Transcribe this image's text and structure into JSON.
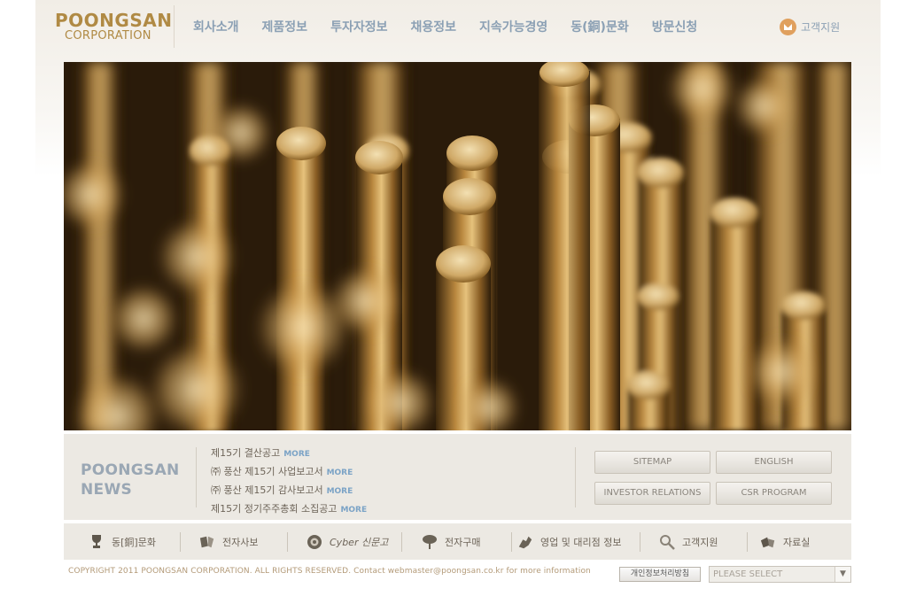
{
  "brand": {
    "logo_line1": "POONGSAN",
    "logo_line2": "CORPORATION",
    "color": "#b08a44"
  },
  "nav": [
    {
      "label": "회사소개"
    },
    {
      "label": "제품정보"
    },
    {
      "label": "투자자정보"
    },
    {
      "label": "채용정보"
    },
    {
      "label": "지속가능경영"
    },
    {
      "label": "동(銅)문화"
    },
    {
      "label": "방문신청"
    }
  ],
  "support": {
    "label": "고객지원",
    "icon": "mail-icon"
  },
  "hero": {
    "image": "brass-rods-photo"
  },
  "news": {
    "title_line1": "POONGSAN",
    "title_line2": "NEWS",
    "more_label": "MORE",
    "items": [
      {
        "text": "제15기 결산공고"
      },
      {
        "text": "㈜ 풍산 제15기 사업보고서"
      },
      {
        "text": "㈜ 풍산 제15기 감사보고서"
      },
      {
        "text": "제15기 정기주주총회 소집공고"
      }
    ]
  },
  "quick_buttons": {
    "sitemap": "SITEMAP",
    "english": "ENGLISH",
    "investor": "INVESTOR RELATIONS",
    "csr": "CSR PROGRAM"
  },
  "bottom_menu": [
    {
      "label": "동[銅]문화",
      "icon": "trophy-icon"
    },
    {
      "label": "전자사보",
      "icon": "book-icon"
    },
    {
      "label": "Cyber 신문고",
      "icon": "drum-icon"
    },
    {
      "label": "전자구매",
      "icon": "tree-icon"
    },
    {
      "label": "영업 및 대리점 정보",
      "icon": "handshake-icon"
    },
    {
      "label": "고객지원",
      "icon": "magnifier-icon"
    },
    {
      "label": "자료실",
      "icon": "books-icon"
    }
  ],
  "footer": {
    "copyright": "COPYRIGHT 2011 POONGSAN CORPORATION. ALL RIGHTS RESERVED. Contact webmaster@poongsan.co.kr for more information",
    "privacy_label": "개인정보처리방침",
    "select_value": "PLEASE SELECT"
  }
}
